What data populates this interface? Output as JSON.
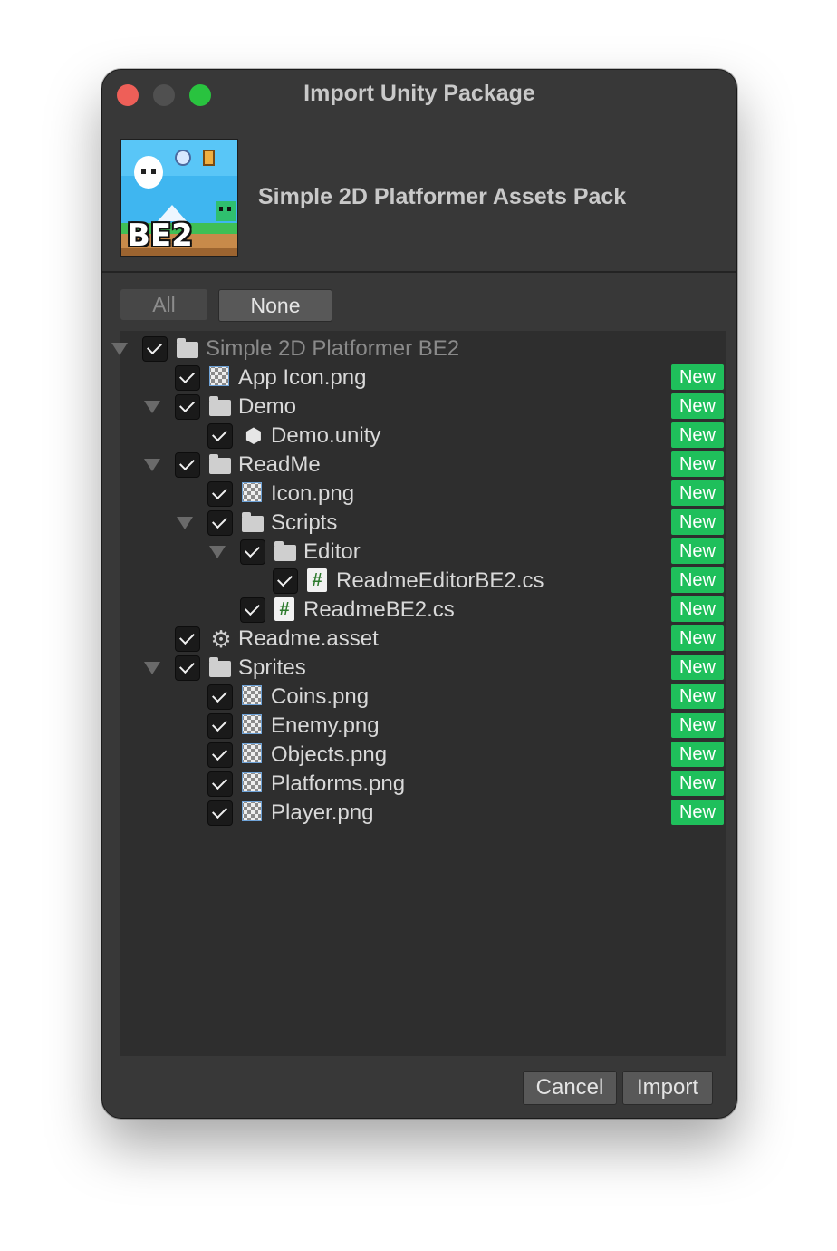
{
  "window": {
    "title": "Import Unity Package"
  },
  "header": {
    "package_name": "Simple 2D Platformer Assets Pack",
    "icon_text": "BE2"
  },
  "toolbar": {
    "all_label": "All",
    "none_label": "None"
  },
  "tree": [
    {
      "label": "Simple 2D Platformer BE2",
      "icon": "folder-icon",
      "depth": 0,
      "expandable": true,
      "checked": true,
      "badge": ""
    },
    {
      "label": "App Icon.png",
      "icon": "image-icon",
      "depth": 1,
      "expandable": false,
      "checked": true,
      "badge": "New"
    },
    {
      "label": "Demo",
      "icon": "folder-icon",
      "depth": 1,
      "expandable": true,
      "checked": true,
      "badge": "New"
    },
    {
      "label": "Demo.unity",
      "icon": "unity-icon",
      "depth": 2,
      "expandable": false,
      "checked": true,
      "badge": "New"
    },
    {
      "label": "ReadMe",
      "icon": "folder-icon",
      "depth": 1,
      "expandable": true,
      "checked": true,
      "badge": "New"
    },
    {
      "label": "Icon.png",
      "icon": "image-icon",
      "depth": 2,
      "expandable": false,
      "checked": true,
      "badge": "New"
    },
    {
      "label": "Scripts",
      "icon": "folder-icon",
      "depth": 2,
      "expandable": true,
      "checked": true,
      "badge": "New"
    },
    {
      "label": "Editor",
      "icon": "folder-icon",
      "depth": 3,
      "expandable": true,
      "checked": true,
      "badge": "New"
    },
    {
      "label": "ReadmeEditorBE2.cs",
      "icon": "cs-icon",
      "depth": 4,
      "expandable": false,
      "checked": true,
      "badge": "New"
    },
    {
      "label": "ReadmeBE2.cs",
      "icon": "cs-icon",
      "depth": 3,
      "expandable": false,
      "checked": true,
      "badge": "New"
    },
    {
      "label": "Readme.asset",
      "icon": "gear-icon",
      "depth": 1,
      "expandable": false,
      "checked": true,
      "badge": "New"
    },
    {
      "label": "Sprites",
      "icon": "folder-icon",
      "depth": 1,
      "expandable": true,
      "checked": true,
      "badge": "New"
    },
    {
      "label": "Coins.png",
      "icon": "image-icon",
      "depth": 2,
      "expandable": false,
      "checked": true,
      "badge": "New"
    },
    {
      "label": "Enemy.png",
      "icon": "image-icon",
      "depth": 2,
      "expandable": false,
      "checked": true,
      "badge": "New"
    },
    {
      "label": "Objects.png",
      "icon": "image-icon",
      "depth": 2,
      "expandable": false,
      "checked": true,
      "badge": "New"
    },
    {
      "label": "Platforms.png",
      "icon": "image-icon",
      "depth": 2,
      "expandable": false,
      "checked": true,
      "badge": "New"
    },
    {
      "label": "Player.png",
      "icon": "image-icon",
      "depth": 2,
      "expandable": false,
      "checked": true,
      "badge": "New"
    }
  ],
  "footer": {
    "cancel_label": "Cancel",
    "import_label": "Import"
  },
  "colors": {
    "window_bg": "#383838",
    "tree_bg": "#2e2e2e",
    "badge_bg": "#1fbf5b",
    "close": "#ee5f58",
    "maximize": "#29c33f"
  }
}
